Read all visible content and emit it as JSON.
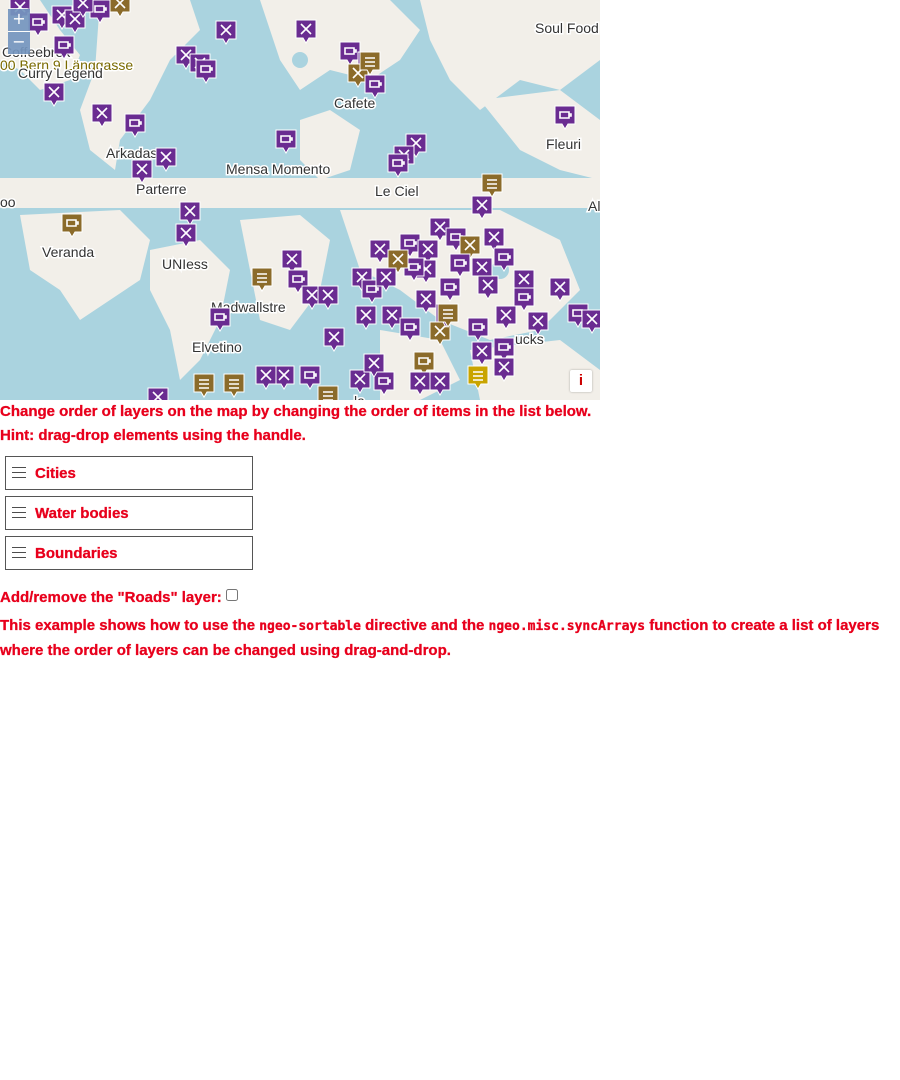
{
  "map": {
    "zoom_in": "+",
    "zoom_out": "−",
    "info_button": "i",
    "colors": {
      "water": "#aad3df",
      "land": "#f2efe9",
      "poi_purple": "#6a2c91",
      "poi_brown": "#8b6b2a"
    },
    "place_labels": [
      "Soul Food",
      "Coffeebrek",
      "00 Bern 9 Länggasse",
      "Curry Legend",
      "Cafete",
      "Arkadas",
      "Fleuri",
      "Mensa Momento",
      "Parterre",
      "Le Ciel",
      "oo",
      "Al",
      "Veranda",
      "UNIess",
      "Madwallstre",
      "Elvetino",
      "ucks",
      "la"
    ]
  },
  "description": {
    "line1": "Change order of layers on the map by changing the order of items in the list below.",
    "line2": "Hint: drag-drop elements using the handle."
  },
  "layers": [
    {
      "label": "Cities"
    },
    {
      "label": "Water bodies"
    },
    {
      "label": "Boundaries"
    }
  ],
  "roads_toggle": {
    "label": "Add/remove the \"Roads\" layer:",
    "checked": false
  },
  "footer": {
    "text1": "This example shows how to use the ",
    "code1": "ngeo-sortable",
    "text2": " directive and the ",
    "code2": "ngeo.misc.syncArrays",
    "text3": " function to create a list of layers where the order of layers can be changed using drag-and-drop."
  }
}
